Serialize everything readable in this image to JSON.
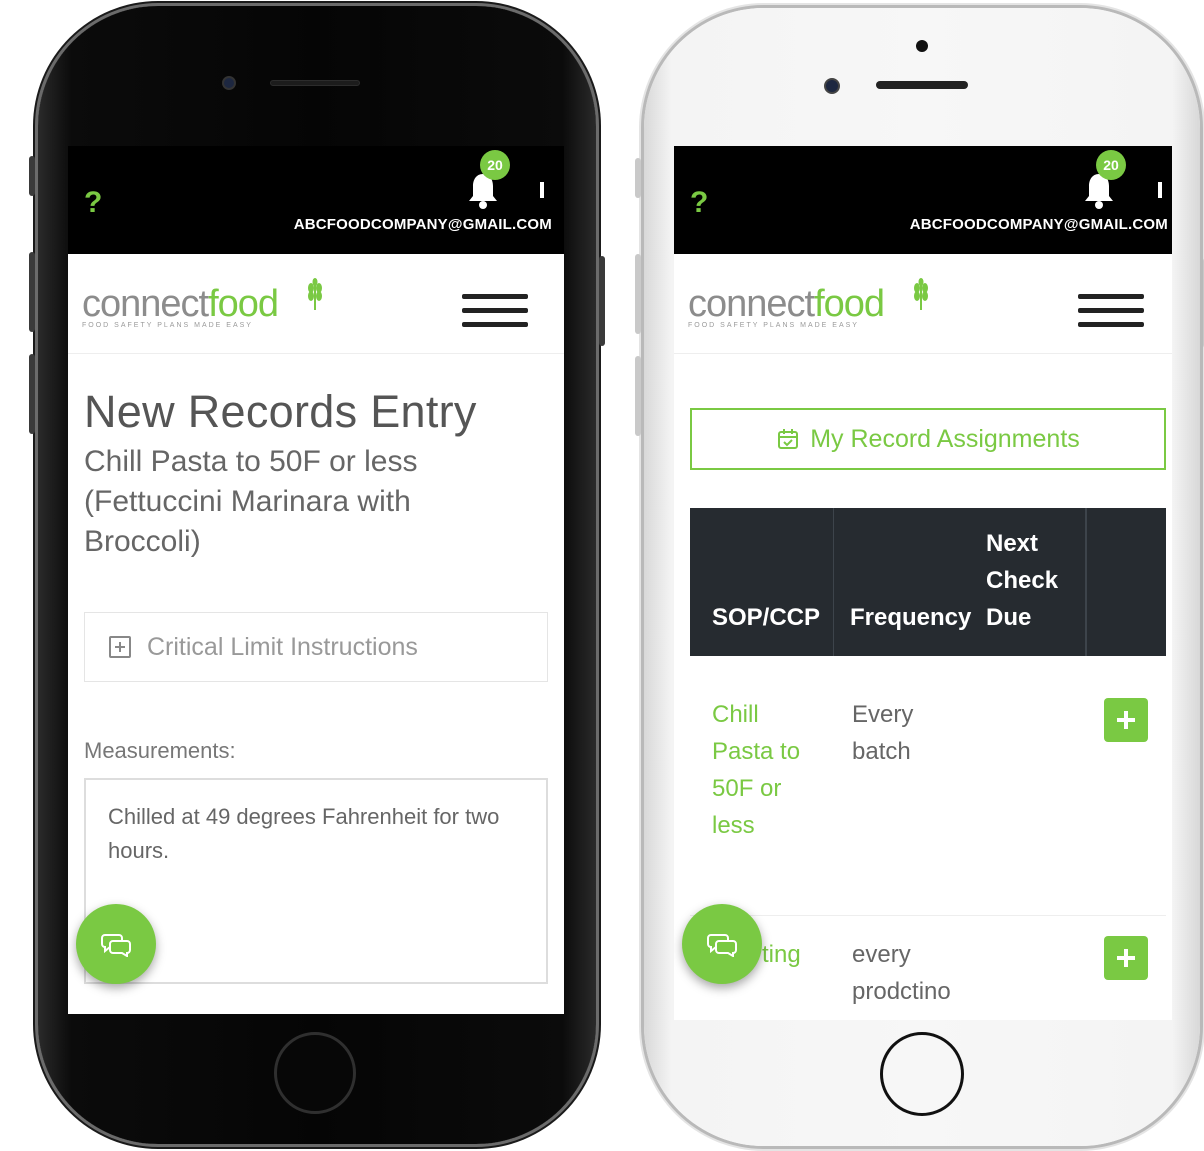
{
  "left_screen": {
    "header": {
      "help_label": "?",
      "notification_count": "20",
      "email": "ABCFOODCOMPANY@GMAIL.COM"
    },
    "logo": {
      "part1": "connect",
      "part2": "food",
      "tagline": "FOOD SAFETY PLANS MADE EASY"
    },
    "title": "New Records Entry",
    "subtitle": "Chill Pasta to 50F or less (Fettuccini Marinara with Broccoli)",
    "instructions_label": "Critical Limit Instructions",
    "measurements_label": "Measurements:",
    "measurements_value": "Chilled at 49 degrees Fahrenheit for two hours."
  },
  "right_screen": {
    "header": {
      "help_label": "?",
      "notification_count": "20",
      "email": "ABCFOODCOMPANY@GMAIL.COM"
    },
    "logo": {
      "part1": "connect",
      "part2": "food",
      "tagline": "FOOD SAFETY PLANS MADE EASY"
    },
    "assignments_button": "My Record Assignments",
    "table": {
      "columns": [
        "SOP/CCP",
        "Frequency",
        "Next Check Due",
        ""
      ],
      "rows": [
        {
          "sop": "Chill Pasta to 50F or less",
          "frequency": "Every batch",
          "next_due": ""
        },
        {
          "sop": "ting",
          "frequency": "every prodctino",
          "next_due": ""
        }
      ]
    }
  },
  "colors": {
    "brand_green": "#7ac943",
    "header_black": "#000000",
    "table_header": "#262b30"
  },
  "icons": [
    "help-icon",
    "bell-icon",
    "kebab-icon",
    "wheat-icon",
    "hamburger-icon",
    "plus-square-icon",
    "calendar-icon",
    "chat-icon",
    "add-icon"
  ]
}
